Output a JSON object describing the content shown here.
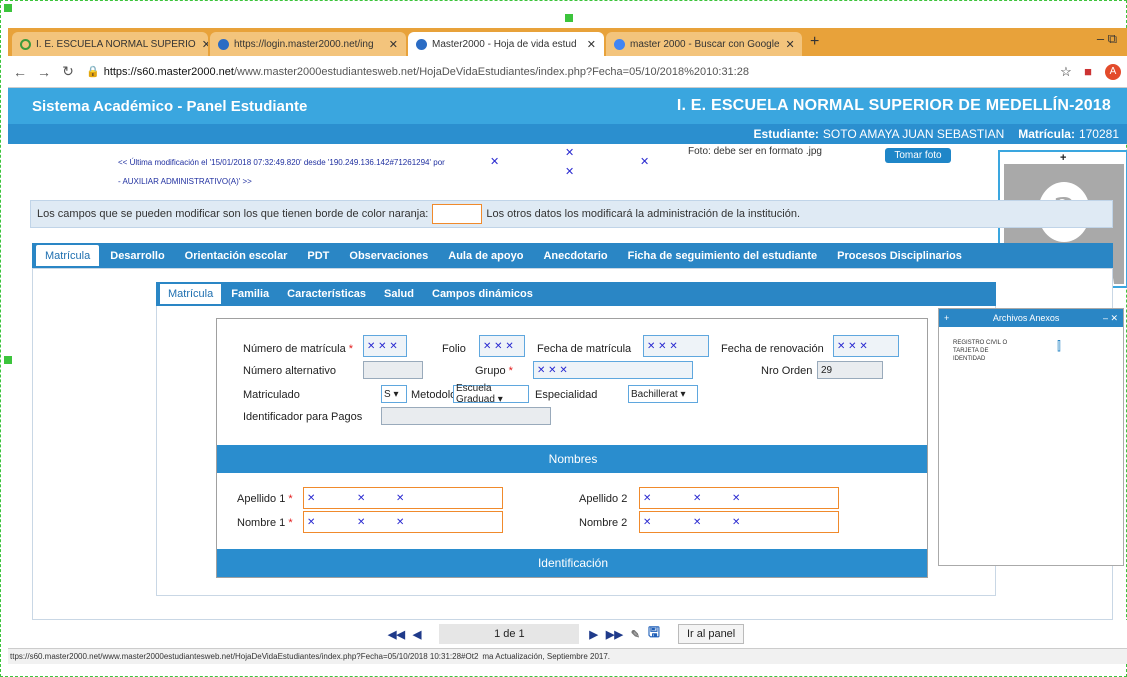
{
  "browser": {
    "tabs": [
      {
        "label": "I. E. ESCUELA NORMAL SUPERIO",
        "icon": "green-circle-icon",
        "color": "#3c9a3c"
      },
      {
        "label": "https://login.master2000.net/ing",
        "icon": "master2000-icon",
        "color": "#2b6cc4"
      },
      {
        "label": "Master2000 - Hoja de vida estud",
        "icon": "master2000-icon",
        "color": "#2b6cc4",
        "active": true
      },
      {
        "label": "master 2000 - Buscar con Google",
        "icon": "google-icon",
        "color": "#4285f4"
      }
    ],
    "new_tab": "+",
    "url_domain": "https://s60.master2000.net",
    "url_path": "/www.master2000estudiantesweb.net/HojaDeVidaEstudiantes/index.php?Fecha=05/10/2018%2010:31:28",
    "window_controls": "– ⧉"
  },
  "header": {
    "app_title": "Sistema Académico - Panel Estudiante",
    "institution": "I. E. ESCUELA NORMAL SUPERIOR DE MEDELLÍN-2018",
    "student_label": "Estudiante:",
    "student_name": "SOTO AMAYA JUAN SEBASTIAN",
    "matricula_label": "Matrícula:",
    "matricula_value": "170281"
  },
  "info": {
    "last_mod": "<< Última modificación el '15/01/2018 07:32:49.820' desde '190.249.136.142#71261294' por",
    "role": "- AUXILIAR ADMINISTRATIVO(A)' >>",
    "photo_note": "Foto: debe ser en formato .jpg",
    "take_photo": "Tomar foto"
  },
  "notice": {
    "before": "Los campos que se pueden modificar son los que tienen borde de color naranja:",
    "after": "Los otros datos los modificará la administración de la institución."
  },
  "main_tabs": [
    "Matrícula",
    "Desarrollo",
    "Orientación escolar",
    "PDT",
    "Observaciones",
    "Aula de apoyo",
    "Anecdotario",
    "Ficha de seguimiento del estudiante",
    "Procesos Disciplinarios"
  ],
  "sub_tabs": [
    "Matrícula",
    "Familia",
    "Características",
    "Salud",
    "Campos dinámicos"
  ],
  "form": {
    "numero_matricula": "Número de matrícula",
    "folio": "Folio",
    "fecha_matricula": "Fecha de matrícula",
    "fecha_renovacion": "Fecha de renovación",
    "numero_alternativo": "Número alternativo",
    "grupo": "Grupo",
    "nro_orden": "Nro Orden",
    "nro_orden_value": "29",
    "matriculado": "Matriculado",
    "matriculado_value": "S ▾",
    "metodologia": "Metodología",
    "metodologia_value": "Escuela Graduad ▾",
    "especialidad": "Especialidad",
    "especialidad_value": "Bachillerat ▾",
    "identificador_pagos": "Identificador para Pagos",
    "req": "*",
    "nombres_bar": "Nombres",
    "apellido1": "Apellido 1",
    "apellido2": "Apellido 2",
    "nombre1": "Nombre 1",
    "nombre2": "Nombre 2",
    "identificacion_bar": "Identificación"
  },
  "annex": {
    "title": "Archivos Anexos",
    "plus": "+",
    "close": "– ✕",
    "items": [
      "REGISTRO CIVIL O",
      "TARJETA DE",
      "IDENTIDAD"
    ]
  },
  "photo": {
    "plus": "+",
    "placeholder": "?"
  },
  "pager": {
    "first": "◀◀",
    "prev": "◀",
    "page": "1 de 1",
    "next": "▶",
    "last": "▶▶",
    "go_panel": "Ir al panel"
  },
  "status": {
    "url": "ttps://s60.master2000.net/www.master2000estudiantesweb.net/HojaDeVidaEstudiantes/index.php?Fecha=05/10/2018 10:31:28#Ot2",
    "extra": "ma Actualización, Septiembre 2017."
  }
}
